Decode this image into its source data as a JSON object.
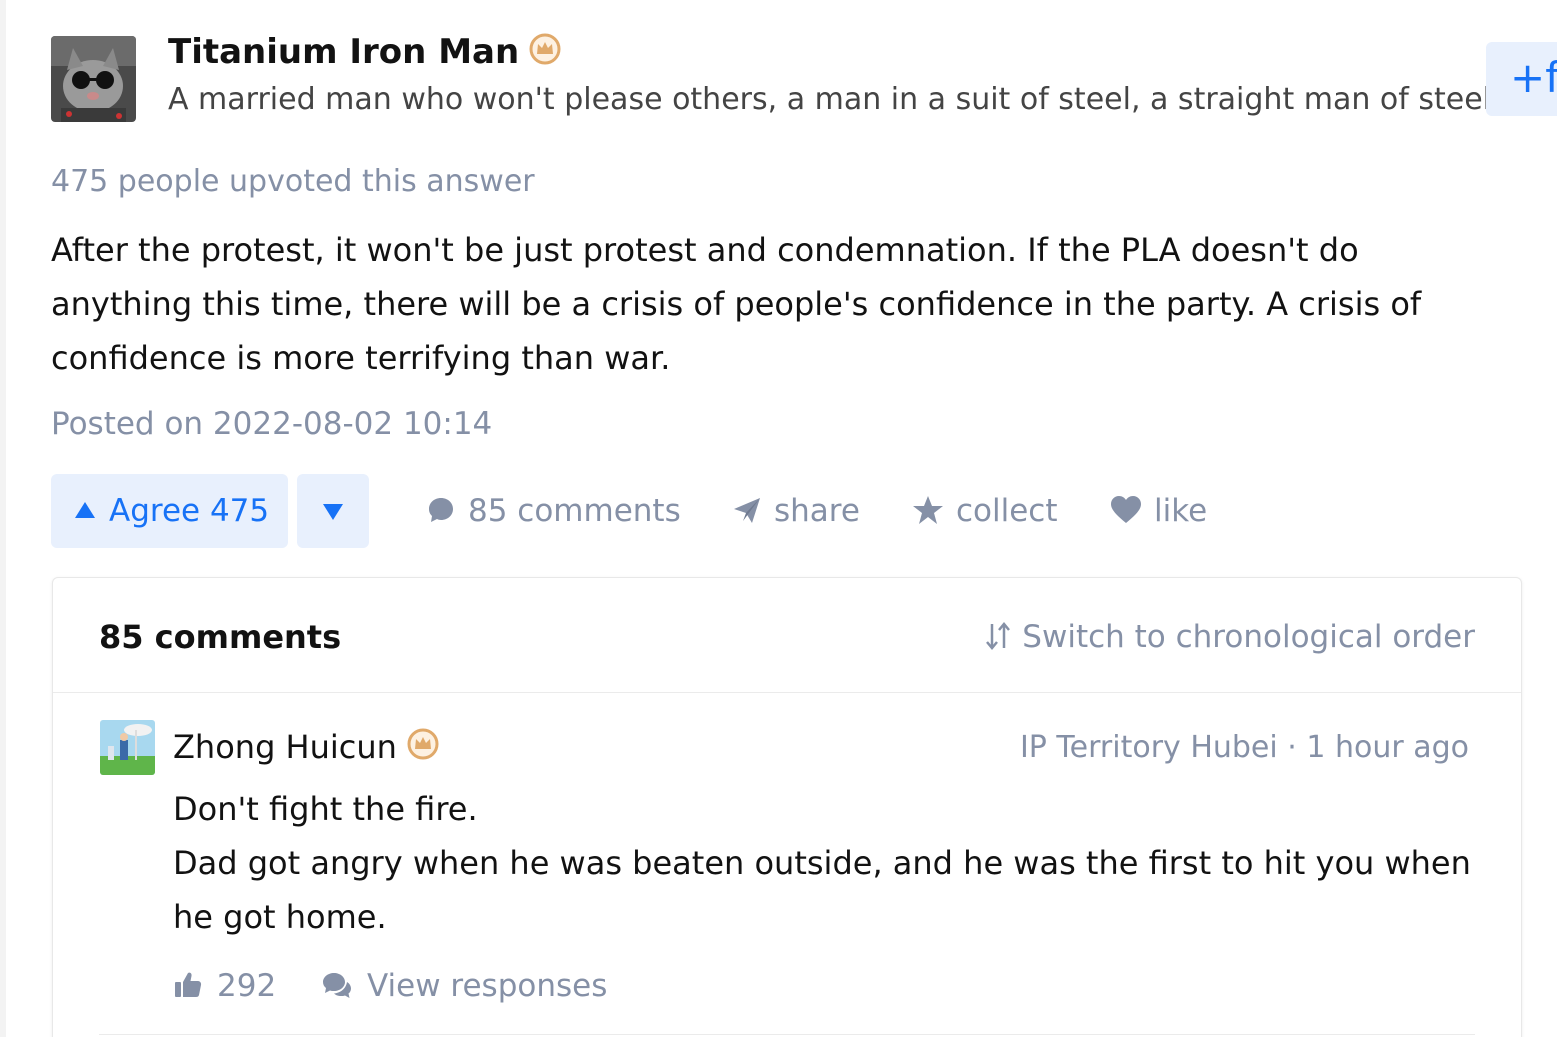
{
  "author": {
    "name": "Titanium Iron Man",
    "bio": "A married man who won't please others, a man in a suit of steel, a straight man of steel.",
    "follow_label": "+f"
  },
  "answer": {
    "upvote_summary": "475 people upvoted this answer",
    "body": "After the protest, it won't be just protest and condemnation. If the PLA doesn't do anything this time, there will be a crisis of people's confidence in the party. A crisis of confidence is more terrifying than war.",
    "posted": "Posted on 2022-08-02 10:14"
  },
  "actions": {
    "agree_label": "Agree 475",
    "comments_label": "85 comments",
    "share_label": "share",
    "collect_label": "collect",
    "like_label": "like"
  },
  "comments": {
    "title": "85 comments",
    "sort_label": "Switch to chronological order",
    "items": [
      {
        "name": "Zhong Huicun",
        "meta": "IP Territory Hubei · 1 hour ago",
        "lines": [
          "Don't fight the fire.",
          "Dad got angry when he was beaten outside, and he was the first to hit you when he got home."
        ],
        "likes": "292",
        "responses_label": "View responses"
      }
    ]
  },
  "icons": {
    "badge": "crown-badge-icon",
    "agree": "triangle-up-icon",
    "disagree": "triangle-down-icon",
    "comments": "comment-bubble-icon",
    "share": "paper-plane-icon",
    "collect": "star-icon",
    "like": "heart-icon",
    "sort": "sort-arrows-icon",
    "thumbs_up": "thumbs-up-icon",
    "responses": "chat-bubbles-icon"
  },
  "colors": {
    "accent_blue": "#1772f6",
    "accent_bg": "#e8f0fd",
    "muted_text": "#8590a6",
    "badge_gold": "#e0a96a"
  }
}
